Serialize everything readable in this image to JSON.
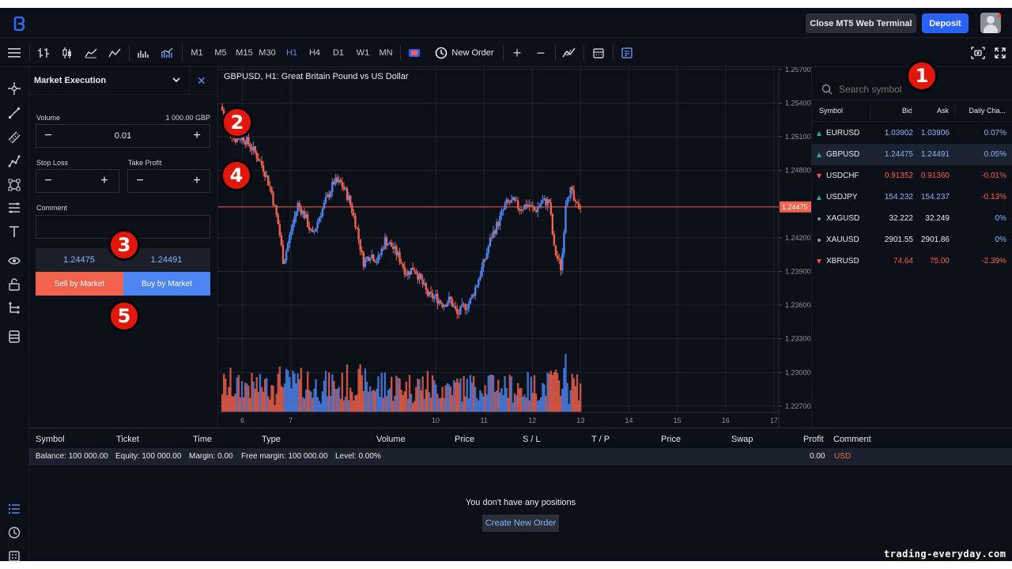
{
  "topbar": {
    "close_label": "Close MT5 Web Terminal",
    "deposit_label": "Deposit"
  },
  "toolbar": {
    "timeframes": [
      "M1",
      "M5",
      "M15",
      "M30",
      "H1",
      "H4",
      "D1",
      "W1",
      "MN"
    ],
    "active_timeframe": "H1",
    "new_order_label": "New Order",
    "chart_type_icons": [
      "bar-chart-icon",
      "candlestick-icon",
      "area-chart-icon",
      "line-chart-icon",
      "volume-bars-icon",
      "volume-area-icon"
    ]
  },
  "order_panel": {
    "type_label": "Market Execution",
    "volume_label": "Volume",
    "volume_money": "1 000.00 GBP",
    "volume_value": "0.01",
    "stop_loss_label": "Stop Loss",
    "take_profit_label": "Take Profit",
    "comment_label": "Comment",
    "bid": "1.24475",
    "ask": "1.24491",
    "sell_label": "Sell by Market",
    "buy_label": "Buy by Market"
  },
  "chart": {
    "title": "GBPUSD, H1: Great Britain Pound vs US Dollar",
    "current_price_label": "1.24475",
    "price_ticks": [
      "1.25700",
      "1.25400",
      "1.25100",
      "1.24800",
      "1.24200",
      "1.23900",
      "1.23600",
      "1.23300",
      "1.23000",
      "1.22700"
    ],
    "date_ticks": [
      "6",
      "7",
      "10",
      "11",
      "12",
      "13",
      "14",
      "15",
      "16",
      "17"
    ],
    "colors": {
      "up": "#4d86f2",
      "down": "#f2624c",
      "price_line": "#f2624c"
    }
  },
  "chart_data": {
    "type": "candlestick",
    "title": "GBPUSD, H1: Great Britain Pound vs US Dollar",
    "ylim": [
      1.2265,
      1.2572
    ],
    "x_range": [
      5.5,
      17.1
    ],
    "last_price": 1.24475,
    "close_path": [
      [
        5.55,
        1.2537
      ],
      [
        5.7,
        1.2521
      ],
      [
        5.85,
        1.2508
      ],
      [
        6.0,
        1.251
      ],
      [
        6.15,
        1.2503
      ],
      [
        6.3,
        1.2493
      ],
      [
        6.45,
        1.2481
      ],
      [
        6.6,
        1.2461
      ],
      [
        6.75,
        1.243
      ],
      [
        6.85,
        1.2398
      ],
      [
        7.0,
        1.2425
      ],
      [
        7.15,
        1.245
      ],
      [
        7.3,
        1.2439
      ],
      [
        7.45,
        1.2421
      ],
      [
        7.6,
        1.244
      ],
      [
        7.75,
        1.2455
      ],
      [
        7.9,
        1.247
      ],
      [
        8.05,
        1.2468
      ],
      [
        8.2,
        1.2455
      ],
      [
        8.35,
        1.2432
      ],
      [
        8.5,
        1.2398
      ],
      [
        8.65,
        1.2406
      ],
      [
        8.8,
        1.2399
      ],
      [
        8.95,
        1.2418
      ],
      [
        9.1,
        1.2412
      ],
      [
        9.25,
        1.2402
      ],
      [
        9.4,
        1.2388
      ],
      [
        9.55,
        1.2394
      ],
      [
        9.7,
        1.2381
      ],
      [
        9.85,
        1.2368
      ],
      [
        10.0,
        1.2367
      ],
      [
        10.15,
        1.2361
      ],
      [
        10.3,
        1.2365
      ],
      [
        10.45,
        1.2351
      ],
      [
        10.55,
        1.2357
      ],
      [
        10.7,
        1.2362
      ],
      [
        10.85,
        1.2379
      ],
      [
        11.0,
        1.2398
      ],
      [
        11.15,
        1.2421
      ],
      [
        11.3,
        1.2434
      ],
      [
        11.45,
        1.245
      ],
      [
        11.6,
        1.2452
      ],
      [
        11.75,
        1.2446
      ],
      [
        11.9,
        1.245
      ],
      [
        12.05,
        1.2444
      ],
      [
        12.2,
        1.2452
      ],
      [
        12.35,
        1.2452
      ],
      [
        12.45,
        1.241
      ],
      [
        12.6,
        1.2392
      ],
      [
        12.7,
        1.2458
      ],
      [
        12.8,
        1.2462
      ],
      [
        12.9,
        1.2447
      ],
      [
        13.0,
        1.2449
      ]
    ],
    "volume_note": "volume bars in lower panel, unlabeled"
  },
  "watchlist": {
    "search_placeholder": "Search symbol",
    "columns": [
      "Symbol",
      "Bid",
      "Ask",
      "Daily Cha..."
    ],
    "rows": [
      {
        "symbol": "EURUSD",
        "bid": "1.03902",
        "ask": "1.03906",
        "change": "0.07%",
        "dir": "up",
        "selected": false
      },
      {
        "symbol": "GBPUSD",
        "bid": "1.24475",
        "ask": "1.24491",
        "change": "0.05%",
        "dir": "up",
        "selected": true
      },
      {
        "symbol": "USDCHF",
        "bid": "0.91352",
        "ask": "0.91360",
        "change": "-0.01%",
        "dir": "down",
        "selected": false
      },
      {
        "symbol": "USDJPY",
        "bid": "154.232",
        "ask": "154.237",
        "change": "-0.13%",
        "dir": "up",
        "selected": false
      },
      {
        "symbol": "XAGUSD",
        "bid": "32.222",
        "ask": "32.249",
        "change": "0%",
        "dir": "none",
        "selected": false
      },
      {
        "symbol": "XAUUSD",
        "bid": "2901.55",
        "ask": "2901.86",
        "change": "0%",
        "dir": "none",
        "selected": false
      },
      {
        "symbol": "XBRUSD",
        "bid": "74.64",
        "ask": "75.00",
        "change": "-2.39%",
        "dir": "down",
        "selected": false
      }
    ]
  },
  "positions": {
    "columns": [
      "Symbol",
      "Ticket",
      "Time",
      "Type",
      "Volume",
      "Price",
      "S / L",
      "T / P",
      "Price",
      "Swap",
      "Profit",
      "Comment"
    ],
    "balance": "Balance: 100 000.00",
    "equity": "Equity: 100 000.00",
    "margin": "Margin: 0.00",
    "free_margin": "Free margin: 100 000.00",
    "level": "Level: 0.00%",
    "profit_total": "0.00",
    "currency": "USD",
    "empty_text": "You don't have any positions",
    "create_label": "Create New Order"
  },
  "annotations": [
    "1",
    "2",
    "3",
    "4",
    "5"
  ],
  "watermark": "trading-everyday.com"
}
